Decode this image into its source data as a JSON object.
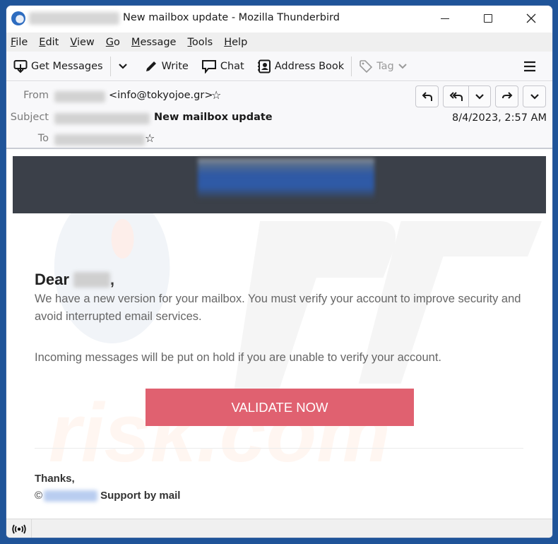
{
  "window": {
    "title": "New mailbox update - Mozilla Thunderbird",
    "title_prefix_redacted": true,
    "controls": {
      "minimize": "minimize",
      "maximize": "maximize",
      "close": "close"
    }
  },
  "menubar": {
    "items": [
      {
        "label": "File",
        "accel": "F",
        "rest": "ile"
      },
      {
        "label": "Edit",
        "accel": "E",
        "rest": "dit"
      },
      {
        "label": "View",
        "accel": "V",
        "rest": "iew"
      },
      {
        "label": "Go",
        "accel": "G",
        "rest": "o"
      },
      {
        "label": "Message",
        "accel": "M",
        "rest": "essage"
      },
      {
        "label": "Tools",
        "accel": "T",
        "rest": "ools"
      },
      {
        "label": "Help",
        "accel": "H",
        "rest": "elp"
      }
    ]
  },
  "toolbar": {
    "get_messages": "Get Messages",
    "write": "Write",
    "chat": "Chat",
    "address_book": "Address Book",
    "tag": "Tag"
  },
  "headers": {
    "from_label": "From",
    "from_email": "<info@tokyojoe.gr>",
    "subject_label": "Subject",
    "subject": "New mailbox update",
    "to_label": "To",
    "date": "8/4/2023, 2:57 AM",
    "actions": [
      "reply",
      "reply-all",
      "more-reply",
      "forward",
      "more"
    ]
  },
  "email": {
    "greeting": "Dear",
    "greeting_suffix": ",",
    "paragraph1": "We have a new version for your mailbox. You must verify your account to improve security and avoid interrupted email services.",
    "paragraph2": "Incoming messages will be put on hold if you are unable to verify your account.",
    "cta_label": "VALIDATE NOW",
    "thanks": "Thanks,",
    "signature_prefix": "©",
    "signature_suffix": "Support by mail"
  },
  "colors": {
    "window_border": "#1f5499",
    "banner_bg": "#3b4049",
    "cta_bg": "#e06170",
    "cta_text": "#ffffff",
    "body_text": "#666666"
  }
}
